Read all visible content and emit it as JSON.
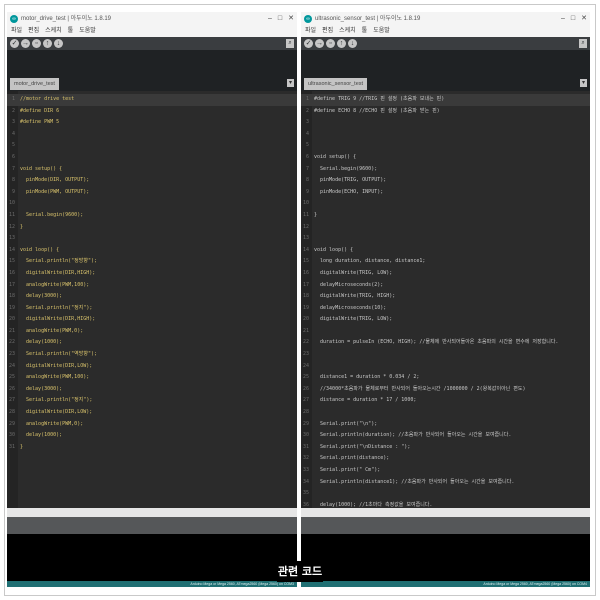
{
  "left_window": {
    "title": "motor_drive_test | 아두이노 1.8.19",
    "menu": [
      "파일",
      "편집",
      "스케치",
      "툴",
      "도움말"
    ],
    "tab_label": "motor_drive_test",
    "code": [
      "//motor drive test",
      "#define DIR 6",
      "#define PWM 5",
      "",
      "",
      "",
      "void setup() {",
      "  pinMode(DIR, OUTPUT);",
      "  pinMode(PWM, OUTPUT);",
      "",
      "  Serial.begin(9600);",
      "}",
      "",
      "void loop() {",
      "  Serial.println(\"정방향\");",
      "  digitalWrite(DIR,HIGH);",
      "  analogWrite(PWM,100);",
      "  delay(3000);",
      "  Serial.println(\"정지\");",
      "  digitalWrite(DIR,HIGH);",
      "  analogWrite(PWM,0);",
      "  delay(1000);",
      "  Serial.println(\"역방향\");",
      "  digitalWrite(DIR,LOW);",
      "  analogWrite(PWM,100);",
      "  delay(3000);",
      "  Serial.println(\"정지\");",
      "  digitalWrite(DIR,LOW);",
      "  analogWrite(PWM,0);",
      "  delay(1000);",
      "}"
    ],
    "status": "Arduino Mega or Mega 2560, ATmega2560 (Mega 2560) on COM3"
  },
  "right_window": {
    "title": "ultrasonic_sensor_test | 아두이노 1.8.19",
    "menu": [
      "파일",
      "편집",
      "스케치",
      "툴",
      "도움말"
    ],
    "tab_label": "ultrasonic_sensor_test",
    "code": [
      "#define TRIG 9 //TRIG 핀 설정 (초음파 보내는 핀)",
      "#define ECHO 8 //ECHO 핀 설정 (초음파 받는 핀)",
      "",
      "",
      "",
      "void setup() {",
      "  Serial.begin(9600);",
      "  pinMode(TRIG, OUTPUT);",
      "  pinMode(ECHO, INPUT);",
      "",
      "}",
      "",
      "",
      "void loop() {",
      "  long duration, distance, distance1;",
      "  digitalWrite(TRIG, LOW);",
      "  delayMicroseconds(2);",
      "  digitalWrite(TRIG, HIGH);",
      "  delayMicroseconds(10);",
      "  digitalWrite(TRIG, LOW);",
      "",
      "  duration = pulseIn (ECHO, HIGH); //물체에 반사되어돌아온 초음파의 시간을 변수에 저장합니다.",
      "",
      "",
      "  distance1 = duration * 0.034 / 2;",
      "  //34000*초음파가 물체로부터 반사되어 돌아오는시간 /1000000 / 2(왕복값이아닌 편도)",
      "  distance = duration * 17 / 1000;",
      "",
      "  Serial.print(\"\\n\");",
      "  Serial.println(duration); //초음파가 반사되어 돌아오는 시간을 보여줍니다.",
      "  Serial.print(\"\\nDistance : \");",
      "  Serial.print(distance);",
      "  Serial.print(\" Cm\");",
      "  Serial.println(distance1); //초음파가 반사되어 돌아오는 시간을 보여줍니다.",
      "",
      "  delay(1000); //1초마다 측정값을 보여줍니다.",
      "}"
    ],
    "status": "Arduino Mega or Mega 2560, ATmega2560 (Mega 2560) on COM4"
  },
  "window_controls": {
    "minimize": "–",
    "maximize": "□",
    "close": "✕"
  },
  "toolbar_icons": [
    "verify-icon",
    "upload-icon",
    "new-icon",
    "open-icon",
    "save-icon"
  ],
  "toolbar_glyphs": [
    "✓",
    "→",
    "▫",
    "↑",
    "↓"
  ],
  "serial_monitor_glyph": "⌕",
  "tab_menu_glyph": "▾",
  "app_icon_glyph": "∞",
  "caption": "관련 코드",
  "colors": {
    "editor_bg": "#2b2b2b",
    "toolbar_bg": "#3a3d40",
    "status_bg": "#1f6f73",
    "console_bg": "#000000"
  }
}
